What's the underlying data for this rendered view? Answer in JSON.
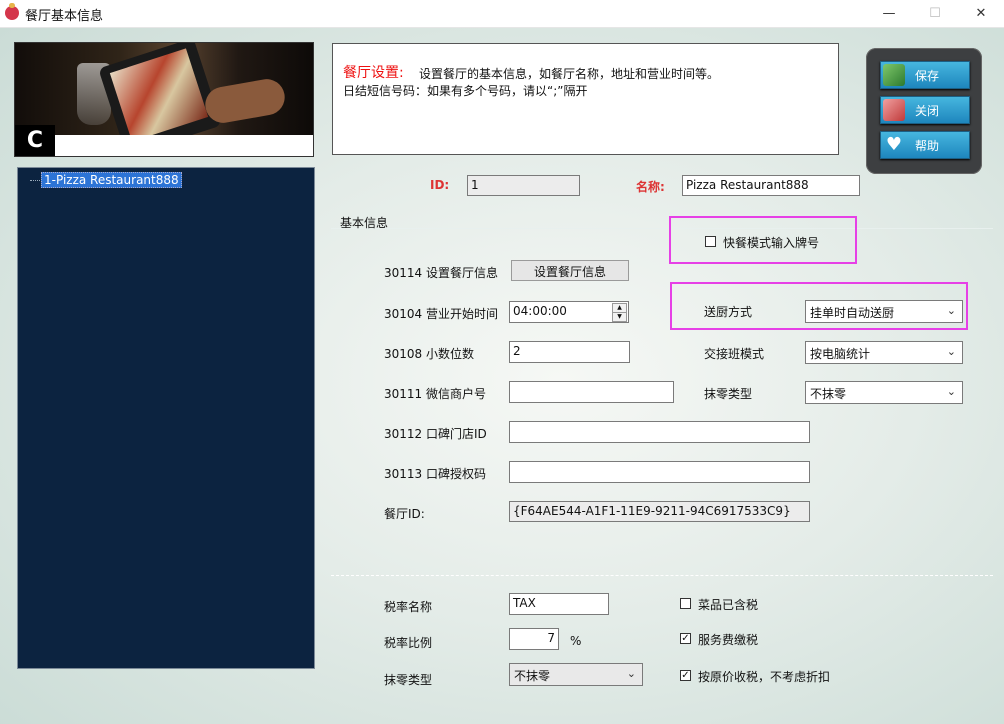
{
  "window": {
    "title": "餐厅基本信息",
    "minimize": "—",
    "maximize": "☐",
    "close": "✕"
  },
  "tree": {
    "items": [
      "1-Pizza Restaurant888"
    ]
  },
  "info": {
    "title": "餐厅设置:",
    "line1": "设置餐厅的基本信息，如餐厅名称，地址和营业时间等。",
    "line2": "日结短信号码：如果有多个号码，请以“;”隔开"
  },
  "side_buttons": {
    "save": "保存",
    "close": "关闭",
    "help": "帮助"
  },
  "header_fields": {
    "id_label": "ID:",
    "id_value": "1",
    "name_label": "名称:",
    "name_value": "Pizza Restaurant888"
  },
  "basic": {
    "group_title": "基本信息",
    "fast_mode_label": "快餐模式输入牌号",
    "r30114_label": "30114 设置餐厅信息",
    "r30114_button": "设置餐厅信息",
    "r30104_label": "30104 营业开始时间",
    "r30104_value": "04:00:00",
    "r30108_label": "30108 小数位数",
    "r30108_value": "2",
    "r30111_label": "30111 微信商户号",
    "r30111_value": "",
    "r30112_label": "30112 口碑门店ID",
    "r30112_value": "",
    "r30113_label": "30113 口碑授权码",
    "r30113_value": "",
    "rid_label": "餐厅ID:",
    "rid_value": "{F64AE544-A1F1-11E9-9211-94C6917533C9}",
    "kitchen_label": "送厨方式",
    "kitchen_value": "挂单时自动送厨",
    "shift_label": "交接班模式",
    "shift_value": "按电脑统计",
    "round_label": "抹零类型",
    "round_value": "不抹零"
  },
  "tax": {
    "name_label": "税率名称",
    "name_value": "TAX",
    "rate_label": "税率比例",
    "rate_value": "7",
    "rate_unit": "%",
    "round_label": "抹零类型",
    "round_value": "不抹零",
    "cb1_label": "菜品已含税",
    "cb1_checked": false,
    "cb2_label": "服务费缴税",
    "cb2_checked": true,
    "cb3_label": "按原价收税，不考虑折扣",
    "cb3_checked": true
  },
  "colors": {
    "accent": "#d33333",
    "highlight": "#e640e6",
    "tree_bg": "#0c2340",
    "button": "#2a9bd0"
  }
}
